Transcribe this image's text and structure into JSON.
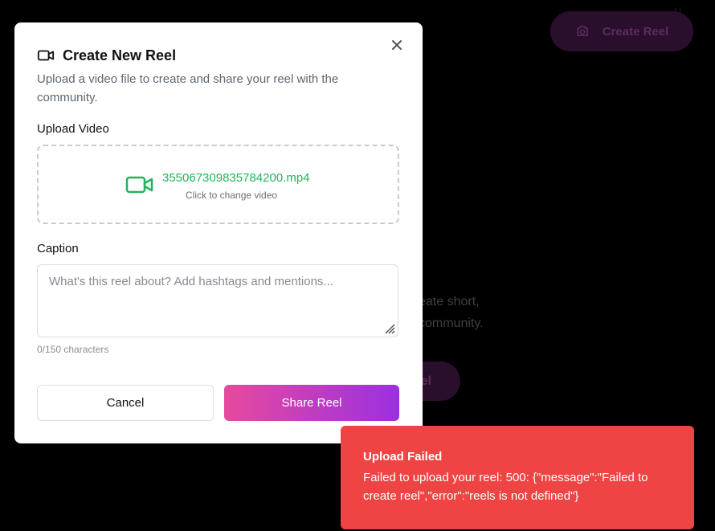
{
  "background": {
    "create_button_label": "Create Reel",
    "empty_text": "eate short, community.",
    "empty_button_label": "el"
  },
  "modal": {
    "title": "Create New Reel",
    "description": "Upload a video file to create and share your reel with the community.",
    "upload_label": "Upload Video",
    "file_name": "3550673098357842​00.mp4",
    "file_hint": "Click to change video",
    "caption_label": "Caption",
    "caption_placeholder": "What's this reel about? Add hashtags and mentions...",
    "caption_value": "",
    "char_count": "0/150 characters",
    "cancel_label": "Cancel",
    "share_label": "Share Reel"
  },
  "toast": {
    "title": "Upload Failed",
    "message": "Failed to upload your reel: 500: {\"message\":\"Failed to create reel\",\"error\":\"reels is not defined\"}"
  },
  "icons": {
    "close": "close-icon",
    "video": "video-camera-icon",
    "camera": "camera-icon"
  },
  "colors": {
    "accent_start": "#e64a9e",
    "accent_end": "#9b30e0",
    "success": "#22b45a",
    "error": "#ef4444"
  }
}
